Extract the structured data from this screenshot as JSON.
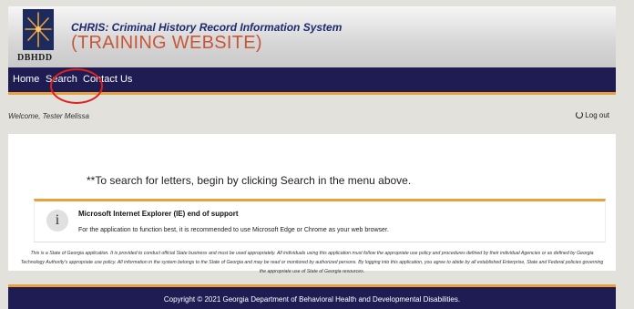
{
  "header": {
    "logo_text": "DBHDD",
    "system_name": "CHRIS: Criminal History Record Information System",
    "site_label": "(TRAINING WEBSITE)"
  },
  "nav": {
    "items": [
      {
        "label": "Home"
      },
      {
        "label": "Search"
      },
      {
        "label": "Contact Us"
      }
    ]
  },
  "welcome_bar": {
    "welcome_text": "Welcome, Tester Melissa",
    "logout_label": "Log out",
    "logout_icon": "power-icon"
  },
  "content": {
    "instructions": "**To search for letters, begin by clicking Search in the menu above.",
    "notice": {
      "icon": "info-icon",
      "icon_glyph": "i",
      "title": "Microsoft Internet Explorer (IE) end of support",
      "body": "For the application to function best, it is recommended to use Microsoft Edge or Chrome as your web browser."
    },
    "disclaimer": "This is a State of Georgia application. It is provided to conduct official State business and must be used appropriately. All individuals using this application must follow the appropriate use policy and procedures defined by their individual Agencies or as defined by Georgia Technology Authority's appropriate use policy. All information in the system belongs to the State of Georgia and may be read or monitored by authorized persons. By logging into this application, you agree to abide by all established Enterprise, State and Federal policies governing the appropriate use of State of Georgia resources."
  },
  "footer": {
    "copyright": "Copyright © 2021 Georgia Department of Behavioral Health and Developmental Disabilities."
  },
  "colors": {
    "nav_bg": "#1f1c54",
    "accent": "#e9a23b",
    "training_text": "#c8573a",
    "annotation": "#e0201b"
  }
}
